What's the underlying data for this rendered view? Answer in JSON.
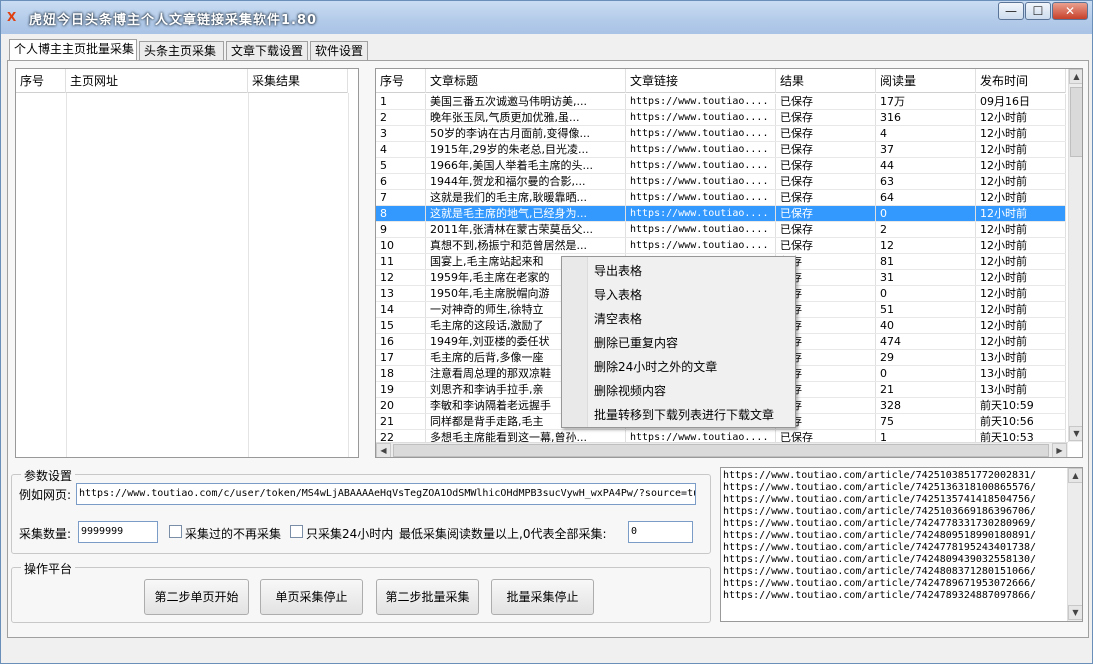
{
  "window": {
    "title": "虎妞今日头条博主个人文章链接采集软件1.80",
    "icon_text": "X",
    "minimize": "—",
    "maximize": "☐",
    "close": "✕"
  },
  "tabs": [
    "个人博主主页批量采集",
    "头条主页采集",
    "文章下载设置",
    "软件设置"
  ],
  "left_table": {
    "headers": [
      "序号",
      "主页网址",
      "采集结果"
    ]
  },
  "right_table": {
    "headers": [
      "序号",
      "文章标题",
      "文章链接",
      "结果",
      "阅读量",
      "发布时间"
    ],
    "rows": [
      [
        "1",
        "美国三番五次诚邀马伟明访美,...",
        "https://www.toutiao....",
        "已保存",
        "17万",
        "09月16日"
      ],
      [
        "2",
        "晚年张玉凤,气质更加优雅,虽...",
        "https://www.toutiao....",
        "已保存",
        "316",
        "12小时前"
      ],
      [
        "3",
        "50岁的李讷在古月面前,变得像...",
        "https://www.toutiao....",
        "已保存",
        "4",
        "12小时前"
      ],
      [
        "4",
        "1915年,29岁的朱老总,目光凌...",
        "https://www.toutiao....",
        "已保存",
        "37",
        "12小时前"
      ],
      [
        "5",
        "1966年,美国人举着毛主席的头...",
        "https://www.toutiao....",
        "已保存",
        "44",
        "12小时前"
      ],
      [
        "6",
        "1944年,贺龙和福尔曼的合影,...",
        "https://www.toutiao....",
        "已保存",
        "63",
        "12小时前"
      ],
      [
        "7",
        "这就是我们的毛主席,耿暖靠晒...",
        "https://www.toutiao....",
        "已保存",
        "64",
        "12小时前"
      ],
      [
        "8",
        "这就是毛主席的地气,已经身为...",
        "https://www.toutiao....",
        "已保存",
        "0",
        "12小时前"
      ],
      [
        "9",
        "2011年,张清林在蒙古荣莫岳父...",
        "https://www.toutiao....",
        "已保存",
        "2",
        "12小时前"
      ],
      [
        "10",
        "真想不到,杨振宁和范曾居然是...",
        "https://www.toutiao....",
        "已保存",
        "12",
        "12小时前"
      ],
      [
        "11",
        "国宴上,毛主席站起来和",
        "",
        "保存",
        "81",
        "12小时前"
      ],
      [
        "12",
        "1959年,毛主席在老家的",
        "",
        "保存",
        "31",
        "12小时前"
      ],
      [
        "13",
        "1950年,毛主席脱帽向游",
        "",
        "保存",
        "0",
        "12小时前"
      ],
      [
        "14",
        "一对神奇的师生,徐特立",
        "",
        "保存",
        "51",
        "12小时前"
      ],
      [
        "15",
        "毛主席的这段话,激励了",
        "",
        "保存",
        "40",
        "12小时前"
      ],
      [
        "16",
        "1949年,刘亚楼的委任状",
        "",
        "保存",
        "474",
        "12小时前"
      ],
      [
        "17",
        "毛主席的后背,多像一座",
        "",
        "保存",
        "29",
        "13小时前"
      ],
      [
        "18",
        "注意看周总理的那双凉鞋",
        "",
        "保存",
        "0",
        "13小时前"
      ],
      [
        "19",
        "刘思齐和李讷手拉手,亲",
        "",
        "保存",
        "21",
        "13小时前"
      ],
      [
        "20",
        "李敏和李讷隔着老远握手",
        "",
        "保存",
        "328",
        "前天10:59"
      ],
      [
        "21",
        "同样都是背手走路,毛主",
        "",
        "保存",
        "75",
        "前天10:56"
      ],
      [
        "22",
        "多想毛主席能看到这一幕,曾孙...",
        "https://www.toutiao....",
        "已保存",
        "1",
        "前天10:53"
      ]
    ],
    "selected_row": 8
  },
  "context_menu": [
    "导出表格",
    "导入表格",
    "清空表格",
    "删除已重复内容",
    "删除24小时之外的文章",
    "删除视频内容",
    "批量转移到下载列表进行下载文章"
  ],
  "params": {
    "group_label": "参数设置",
    "example_label": "例如网页:",
    "example_url": "https://www.toutiao.com/c/user/token/MS4wLjABAAAAeHqVsTegZOA1OdSMWlhicOHdMPB3sucVywH_wxPA4Pw/?source=tu",
    "count_label": "采集数量:",
    "count_value": "9999999",
    "cb1_label": "采集过的不再采集",
    "cb2_label": "只采集24小时内",
    "min_label": "最低采集阅读数量以上,0代表全部采集:",
    "min_value": "0"
  },
  "ops": {
    "group_label": "操作平台",
    "buttons": [
      "第二步单页开始",
      "单页采集停止",
      "第二步批量采集",
      "批量采集停止"
    ]
  },
  "url_list": [
    "https://www.toutiao.com/article/7425103851772002831/",
    "https://www.toutiao.com/article/7425136318100865576/",
    "https://www.toutiao.com/article/7425135741418504756/",
    "https://www.toutiao.com/article/7425103669186396706/",
    "https://www.toutiao.com/article/7424778331730280969/",
    "https://www.toutiao.com/article/7424809518990180891/",
    "https://www.toutiao.com/article/7424778195243401738/",
    "https://www.toutiao.com/article/7424809439032558130/",
    "https://www.toutiao.com/article/7424808371280151066/",
    "https://www.toutiao.com/article/7424789671953072666/",
    "https://www.toutiao.com/article/7424789324887097866/"
  ]
}
